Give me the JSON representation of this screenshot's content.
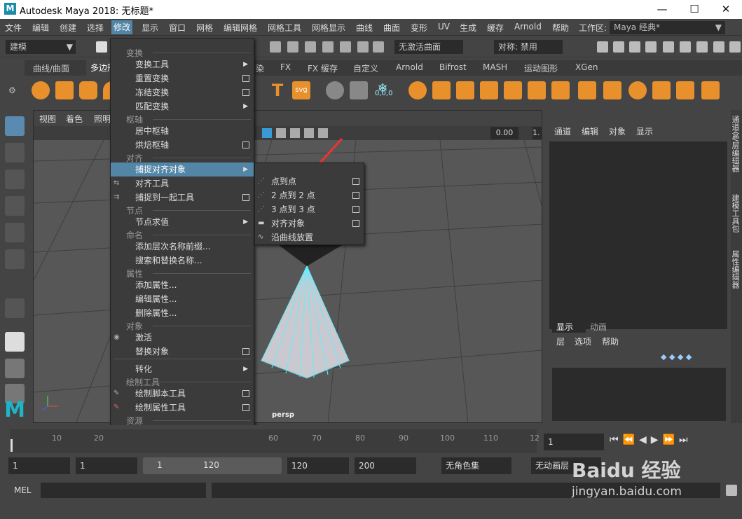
{
  "window": {
    "title": "Autodesk Maya 2018: 无标题*",
    "minimize": "—",
    "maximize": "☐",
    "close": "✕"
  },
  "menubar": {
    "items": [
      "文件",
      "编辑",
      "创建",
      "选择",
      "修改",
      "显示",
      "窗口",
      "网格",
      "编辑网格",
      "网格工具",
      "网格显示",
      "曲线",
      "曲面",
      "变形",
      "UV",
      "生成",
      "缓存",
      "Arnold",
      "帮助"
    ],
    "workspace_label": "工作区:",
    "workspace_value": "Maya 经典*"
  },
  "toolbar": {
    "mode": "建模",
    "no_live_surface": "无激活曲面",
    "symmetry": "对称: 禁用"
  },
  "shelf": {
    "tabs": [
      "曲线/曲面",
      "多边形",
      "染",
      "FX",
      "FX 缓存",
      "自定义",
      "Arnold",
      "Bifrost",
      "MASH",
      "运动图形",
      "XGen"
    ],
    "coord_label": "0,0,0"
  },
  "viewport": {
    "menu": [
      "视图",
      "着色",
      "照明"
    ],
    "camera_label": "persp",
    "field_value": "0.00",
    "field_value2": "1."
  },
  "right_panel": {
    "channel_menu": [
      "通道",
      "编辑",
      "对象",
      "显示"
    ],
    "layer_tabs": [
      "显示",
      "动画"
    ],
    "layer_menu": [
      "层",
      "选项",
      "帮助"
    ],
    "side_tabs": [
      "通道盒/层编辑器",
      "建模工具包",
      "属性编辑器"
    ]
  },
  "modify_menu": {
    "sections": {
      "transform": "变换",
      "pivot": "枢轴",
      "align": "对齐",
      "node": "节点",
      "naming": "命名",
      "attribute": "属性",
      "object": "对象",
      "paint": "绘制工具",
      "asset": "资源"
    },
    "items": {
      "transform_tools": "变换工具",
      "reset_transform": "重置变换",
      "freeze_transform": "冻结变换",
      "match_transform": "匹配变换",
      "center_pivot": "居中枢轴",
      "bake_pivot": "烘焙枢轴",
      "snap_align": "捕捉对齐对象",
      "align_tool": "对齐工具",
      "snap_together": "捕捉到一起工具",
      "eval_nodes": "节点求值",
      "add_prefix": "添加层次名称前缀...",
      "search_replace": "搜索和替换名称...",
      "add_attr": "添加属性...",
      "edit_attr": "编辑属性...",
      "delete_attr": "删除属性...",
      "activate": "激活",
      "replace_obj": "替换对象",
      "convert": "转化",
      "paint_script": "绘制脚本工具",
      "paint_attr": "绘制属性工具",
      "assets": "资源"
    }
  },
  "submenu": {
    "items": [
      "点到点",
      "2 点到 2 点",
      "3 点到 3 点",
      "对齐对象",
      "沿曲线放置"
    ]
  },
  "timeline": {
    "ticks": [
      "10",
      "20",
      "60",
      "70",
      "80",
      "90",
      "100",
      "110",
      "12"
    ],
    "current_frame": "1"
  },
  "range": {
    "start": "1",
    "anim_start": "1",
    "slider_start": "1",
    "slider_end": "120",
    "anim_end": "120",
    "end": "200",
    "char_set": "无角色集",
    "anim_layer": "无动画层"
  },
  "command": {
    "label": "MEL"
  },
  "watermark": {
    "site": "jingyan.baidu.com",
    "brand": "Baidu 经验"
  },
  "accent": "#5285a6"
}
